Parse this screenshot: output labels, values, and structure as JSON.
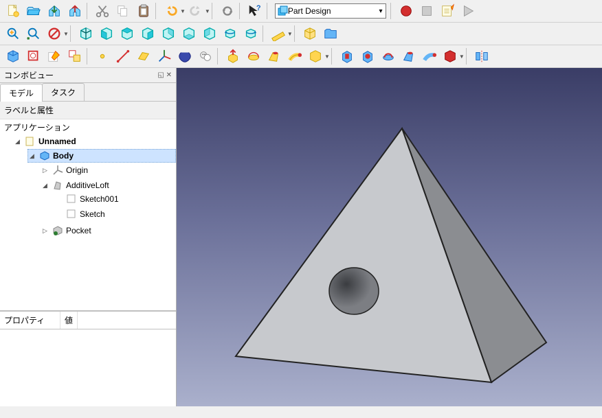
{
  "workbench": {
    "selected": "Part Design"
  },
  "panel": {
    "title": "コンボビュー",
    "tab_model": "モデル",
    "tab_task": "タスク",
    "tree_header": "ラベルと属性",
    "app_root": "アプリケーション",
    "doc": "Unnamed",
    "body": "Body",
    "origin": "Origin",
    "loft": "AdditiveLoft",
    "sketch001": "Sketch001",
    "sketch": "Sketch",
    "pocket": "Pocket"
  },
  "props": {
    "col_prop": "プロパティ",
    "col_val": "値"
  }
}
